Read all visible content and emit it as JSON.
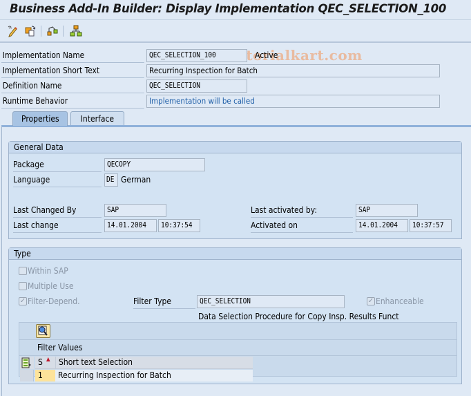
{
  "window": {
    "title": "Business Add-In Builder: Display Implementation QEC_SELECTION_100"
  },
  "toolbar": {
    "buttons": [
      {
        "name": "display-change-icon"
      },
      {
        "name": "other-object-icon"
      },
      {
        "name": "definition-icon"
      },
      {
        "name": "hierarchy-icon"
      }
    ]
  },
  "watermark": "© www.tutorialkart.com",
  "header": {
    "impl_name_label": "Implementation Name",
    "impl_name_value": "QEC_SELECTION_100",
    "impl_status": "Active",
    "short_text_label": "Implementation Short Text",
    "short_text_value": "Recurring Inspection for Batch",
    "definition_label": "Definition Name",
    "definition_value": "QEC_SELECTION",
    "runtime_label": "Runtime Behavior",
    "runtime_value": "Implementation will be called"
  },
  "tabs": [
    {
      "label": "Properties",
      "active": true
    },
    {
      "label": "Interface",
      "active": false
    }
  ],
  "general_data": {
    "title": "General Data",
    "package_label": "Package",
    "package_value": "QECOPY",
    "language_label": "Language",
    "language_code": "DE",
    "language_name": "German",
    "last_changed_by_label": "Last Changed By",
    "last_changed_by_value": "SAP",
    "last_change_label": "Last change",
    "last_change_date": "14.01.2004",
    "last_change_time": "10:37:54",
    "last_activated_by_label": "Last activated by:",
    "last_activated_by_value": "SAP",
    "activated_on_label": "Activated on",
    "activated_on_date": "14.01.2004",
    "activated_on_time": "10:37:57"
  },
  "type": {
    "title": "Type",
    "within_sap": {
      "label": "Within SAP",
      "checked": false
    },
    "multiple_use": {
      "label": "Multiple Use",
      "checked": false
    },
    "filter_depend": {
      "label": "Filter-Depend.",
      "checked": true
    },
    "filter_type_label": "Filter Type",
    "filter_type_value": "QEC_SELECTION",
    "enhanceable": {
      "label": "Enhanceable",
      "checked": true
    },
    "filter_type_desc": "Data Selection Procedure for Copy Insp. Results Funct"
  },
  "filter_values": {
    "title": "Filter Values",
    "columns": [
      "S",
      "Short text Selection"
    ],
    "rows": [
      {
        "s": "1",
        "text": "Recurring Inspection for Batch"
      }
    ]
  }
}
